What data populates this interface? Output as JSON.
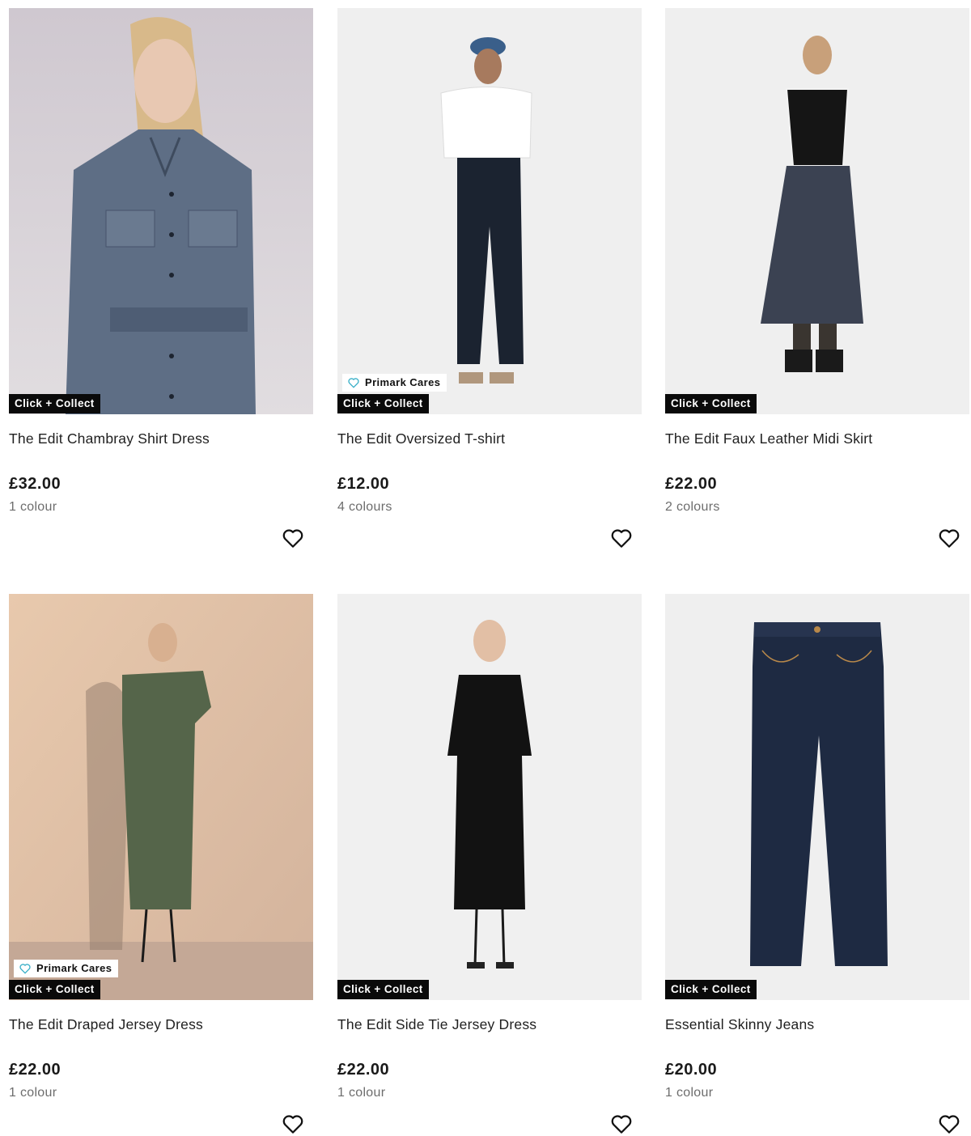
{
  "products": [
    {
      "title": "The Edit Chambray Shirt Dress",
      "price": "£32.00",
      "colours": "1 colour",
      "badge": "Click + Collect",
      "cares": "",
      "image": "chambray-shirt-dress",
      "bg": "#d9d4d8"
    },
    {
      "title": "The Edit Oversized T-shirt",
      "price": "£12.00",
      "colours": "4 colours",
      "badge": "Click + Collect",
      "cares": "Primark Cares",
      "image": "oversized-tshirt",
      "bg": "#efefef"
    },
    {
      "title": "The Edit Faux Leather Midi Skirt",
      "price": "£22.00",
      "colours": "2 colours",
      "badge": "Click + Collect",
      "cares": "",
      "image": "faux-leather-midi-skirt",
      "bg": "#efefef"
    },
    {
      "title": "The Edit Draped Jersey Dress",
      "price": "£22.00",
      "colours": "1 colour",
      "badge": "Click + Collect",
      "cares": "Primark Cares",
      "image": "draped-jersey-dress",
      "bg": "#e3c4a8"
    },
    {
      "title": "The Edit Side Tie Jersey Dress",
      "price": "£22.00",
      "colours": "1 colour",
      "badge": "Click + Collect",
      "cares": "",
      "image": "side-tie-jersey-dress",
      "bg": "#f0f0f0"
    },
    {
      "title": "Essential Skinny Jeans",
      "price": "£20.00",
      "colours": "1 colour",
      "badge": "Click + Collect",
      "cares": "",
      "image": "skinny-jeans",
      "bg": "#efefef"
    }
  ],
  "colors": {
    "badge_bg": "#0a0a0a",
    "cares_heart": "#3ab0c8",
    "muted_text": "#6d6d6d"
  },
  "icons": {
    "favourite": "heart-outline-icon",
    "cares": "heart-outline-teal-icon"
  }
}
